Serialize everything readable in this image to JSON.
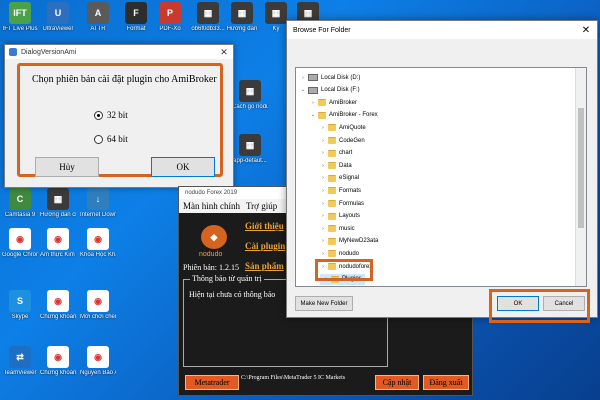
{
  "desktop": {
    "icons": [
      {
        "label": "IFT Live Plus",
        "color": "#4aa14a",
        "glyph": "IFT"
      },
      {
        "label": "UltraViewer",
        "color": "#2c6fbf",
        "glyph": "U"
      },
      {
        "label": "ATTR",
        "color": "#5a5a5a",
        "glyph": "A"
      },
      {
        "label": "Format",
        "color": "#2d2d2d",
        "glyph": "F"
      },
      {
        "label": "PDF-Xo",
        "color": "#c83a2e",
        "glyph": "P"
      },
      {
        "label": "ob6f0db33...",
        "color": "#3b3b3b",
        "glyph": "▦"
      },
      {
        "label": "Hướng dẫn",
        "color": "#3b3b3b",
        "glyph": "▦"
      },
      {
        "label": "Kỳ",
        "color": "#3b3b3b",
        "glyph": "▦"
      },
      {
        "label": "Lưu cẩn thận khi sử dụng",
        "color": "#3b3b3b",
        "glyph": "▦"
      },
      {
        "label": "Camtasia 9",
        "color": "#3e8a3e",
        "glyph": "C"
      },
      {
        "label": "Hướng dẫn chỉ youtube",
        "color": "#3b3b3b",
        "glyph": "▦"
      },
      {
        "label": "Internet Downlo...",
        "color": "#2f7fbf",
        "glyph": "↓"
      },
      {
        "label": "Google Chrome",
        "color": "#ffffff",
        "glyph": "◉"
      },
      {
        "label": "Âm thực Kim Anh...",
        "color": "#ffffff",
        "glyph": "◉"
      },
      {
        "label": "Khóa Học Khai Pha...",
        "color": "#ffffff",
        "glyph": "◉"
      },
      {
        "label": "Skype",
        "color": "#1e90e0",
        "glyph": "S"
      },
      {
        "label": "Chứng khoán Unza",
        "color": "#ffffff",
        "glyph": "◉"
      },
      {
        "label": "Mời chơi chen",
        "color": "#ffffff",
        "glyph": "◉"
      },
      {
        "label": "TeamViewer",
        "color": "#1e6fc4",
        "glyph": "⇄"
      },
      {
        "label": "Chứng khoán LIVE DIL...",
        "color": "#ffffff",
        "glyph": "◉"
      },
      {
        "label": "Nguyễn Bảo Anh - Chrome",
        "color": "#ffffff",
        "glyph": "◉"
      }
    ],
    "right_icons": [
      {
        "label": "Cách gõ nodudo",
        "color": "#3b3b3b"
      },
      {
        "label": "app-defaut...",
        "color": "#3b3b3b"
      }
    ]
  },
  "dialog_version": {
    "title": "DialogVersionAmi",
    "heading": "Chọn phiên bản cài đặt plugin cho AmiBroker",
    "options": [
      "32 bit",
      "64 bit"
    ],
    "selected": "32 bit",
    "cancel_label": "Hủy",
    "ok_label": "OK"
  },
  "browse_folder": {
    "title": "Browse For Folder",
    "tree": [
      {
        "label": "Local Disk (D:)",
        "level": 0,
        "type": "drive",
        "expanded": false
      },
      {
        "label": "Local Disk (F:)",
        "level": 0,
        "type": "drive",
        "expanded": true
      },
      {
        "label": "AmiBroker",
        "level": 1,
        "type": "folder",
        "expanded": false
      },
      {
        "label": "AmiBroker - Forex",
        "level": 1,
        "type": "folder",
        "expanded": true
      },
      {
        "label": "AmiQuote",
        "level": 2,
        "type": "folder",
        "expanded": false
      },
      {
        "label": "CodeGen",
        "level": 2,
        "type": "folder",
        "expanded": false
      },
      {
        "label": "chart",
        "level": 2,
        "type": "folder",
        "expanded": false
      },
      {
        "label": "Data",
        "level": 2,
        "type": "folder",
        "expanded": false
      },
      {
        "label": "eSignal",
        "level": 2,
        "type": "folder",
        "expanded": false
      },
      {
        "label": "Formats",
        "level": 2,
        "type": "folder",
        "expanded": false
      },
      {
        "label": "Formulas",
        "level": 2,
        "type": "folder",
        "expanded": false
      },
      {
        "label": "Layouts",
        "level": 2,
        "type": "folder",
        "expanded": false
      },
      {
        "label": "music",
        "level": 2,
        "type": "folder",
        "expanded": false
      },
      {
        "label": "MyNewD23ata",
        "level": 2,
        "type": "folder",
        "expanded": false
      },
      {
        "label": "nodudo",
        "level": 2,
        "type": "folder",
        "expanded": false
      },
      {
        "label": "nodudoforex",
        "level": 2,
        "type": "folder",
        "expanded": false
      },
      {
        "label": "Plugins",
        "level": 2,
        "type": "folder",
        "expanded": false,
        "selected": true
      }
    ],
    "make_new_folder_label": "Make New Folder",
    "ok_label": "OK",
    "cancel_label": "Cancel"
  },
  "nodudo_app": {
    "title": "nodudo Forex 2019",
    "menu": [
      "Màn hình chính",
      "Trợ giúp"
    ],
    "links": [
      "Giới thiệu",
      "Cài plugin",
      "Sản phẩm"
    ],
    "logo_text": "nodudo",
    "version": "Phiên bản: 1.2.15",
    "notice_legend": "Thông báo từ quản trị",
    "notice_message": "Hiện tại chưa có thông báo",
    "metatrader_label": "Metatrader",
    "path": "C:\\Program Files\\MetaTrader 5 IC Markets",
    "update_label": "Cập nhật",
    "logout_label": "Đăng xuất"
  },
  "colors": {
    "highlight": "#d4641f",
    "accent_orange": "#e05a22"
  }
}
